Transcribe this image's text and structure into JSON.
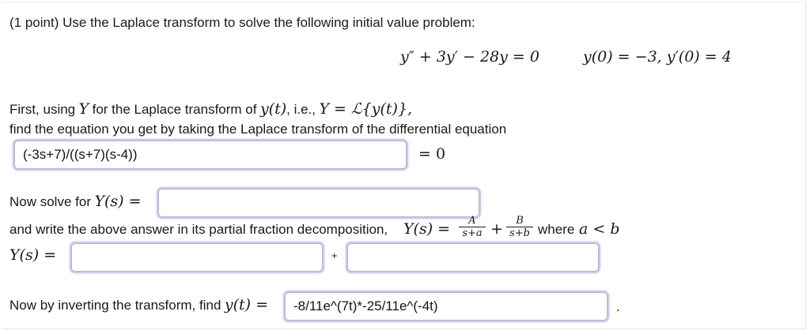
{
  "problem": {
    "header": "(1 point) Use the Laplace transform to solve the following initial value problem:",
    "equation": "y″ + 3y′ − 28y = 0",
    "initial_conditions": "y(0) = −3,  y′(0) = 4"
  },
  "step1": {
    "intro_a": "First, using",
    "Y_symbol": "Y",
    "intro_b": "for the Laplace transform of",
    "yt": "y(t)",
    "intro_c": ", i.e.,",
    "definition": "Y = ℒ{y(t)},",
    "line2": "find the equation you get by taking the Laplace transform of the differential equation",
    "answer_value": "(-3s+7)/((s+7)(s-4))",
    "equals_zero": "= 0"
  },
  "step2": {
    "label": "Now solve for",
    "Ys": "Y(s) =",
    "answer_value": ""
  },
  "step3": {
    "text_a": "and write the above answer in its partial fraction decomposition,",
    "Ys": "Y(s) =",
    "frac1_num": "A",
    "frac1_den": "s+a",
    "plus": "+",
    "frac2_num": "B",
    "frac2_den": "s+b",
    "text_b": "where",
    "condition": "a < b",
    "Ys_row": "Y(s) =",
    "plus_sign": "+",
    "field1_value": "",
    "field2_value": ""
  },
  "step4": {
    "label": "Now by inverting the transform, find",
    "yt": "y(t) =",
    "answer_value": "-8/11e^(7t)*-25/11e^(-4t)",
    "trailing": "."
  }
}
